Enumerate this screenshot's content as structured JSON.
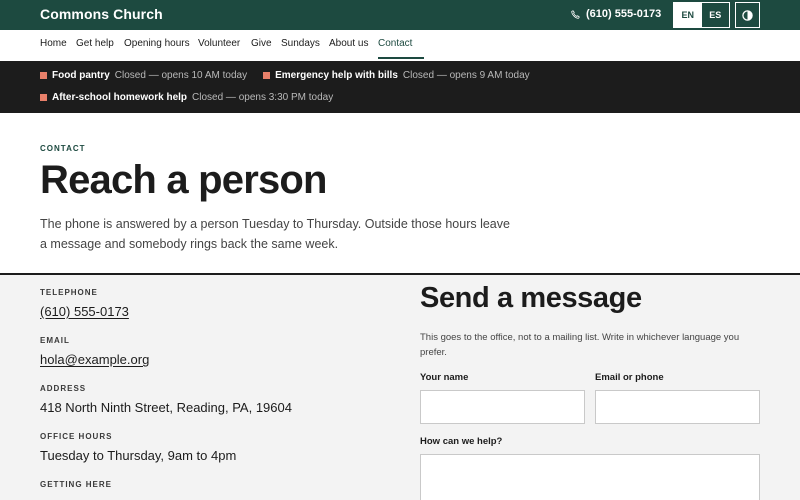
{
  "header": {
    "brand": "Commons Church",
    "phone": "(610) 555-0173",
    "phone_icon": "phone-icon",
    "languages": {
      "en": "EN",
      "es": "ES",
      "selected": "EN"
    },
    "contrast_icon": "contrast-icon"
  },
  "nav": {
    "items": [
      {
        "label": "Home"
      },
      {
        "label": "Get help"
      },
      {
        "label": "Opening hours"
      },
      {
        "label": "Volunteer"
      },
      {
        "label": "Give"
      },
      {
        "label": "Sundays"
      },
      {
        "label": "About us"
      },
      {
        "label": "Contact"
      }
    ],
    "active": "Contact"
  },
  "status": [
    {
      "name": "Food pantry",
      "state": "Closed — opens 10 AM today"
    },
    {
      "name": "Emergency help with bills",
      "state": "Closed — opens 9 AM today"
    },
    {
      "name": "After-school homework help",
      "state": "Closed — opens 3:30 PM today"
    }
  ],
  "hero": {
    "eyebrow": "CONTACT",
    "title": "Reach a person",
    "intro": "The phone is answered by a person Tuesday to Thursday. Outside those hours leave a message and somebody rings back the same week."
  },
  "contact": {
    "telephone_label": "TELEPHONE",
    "telephone": "(610) 555-0173",
    "email_label": "EMAIL",
    "email": "hola@example.org",
    "address_label": "ADDRESS",
    "address": "418 North Ninth Street, Reading, PA, 19604",
    "hours_label": "OFFICE HOURS",
    "hours": "Tuesday to Thursday, 9am to 4pm",
    "getting_here_label": "GETTING HERE"
  },
  "form": {
    "title": "Send a message",
    "note": "This goes to the office, not to a mailing list. Write in whichever language you prefer.",
    "name_label": "Your name",
    "name_value": "",
    "contact_label": "Email or phone",
    "contact_value": "",
    "help_label": "How can we help?",
    "help_value": ""
  },
  "colors": {
    "brand_green": "#1d4a40",
    "status_bg": "#1c1c1c",
    "status_marker": "#e8806a",
    "lower_bg": "#f3f3f3"
  }
}
